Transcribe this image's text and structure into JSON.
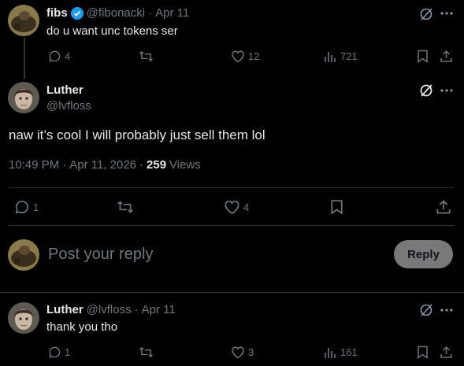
{
  "tweet1": {
    "name": "fibs",
    "handle": "@fibonacki",
    "dot": "·",
    "date": "Apr 11",
    "text": "do u want unc tokens ser",
    "replies": "4",
    "likes": "12",
    "views": "721"
  },
  "main": {
    "name": "Luther",
    "handle": "@lvfloss",
    "text": "naw it’s cool I will probably just sell them lol",
    "time": "10:49 PM",
    "dot": "·",
    "date": "Apr 11, 2026",
    "views_count": "259",
    "views_label": "Views",
    "replies": "1",
    "likes": "4"
  },
  "reply_box": {
    "placeholder": "Post your reply",
    "button_label": "Reply"
  },
  "tweet3": {
    "name": "Luther",
    "handle": "@lvfloss",
    "dot": "·",
    "date": "Apr 11",
    "text": "thank you tho",
    "replies": "1",
    "likes": "3",
    "views": "161"
  },
  "icons": {
    "more": "more-icon",
    "grok": "grok-icon",
    "verified_color": "#1d9bf0"
  }
}
